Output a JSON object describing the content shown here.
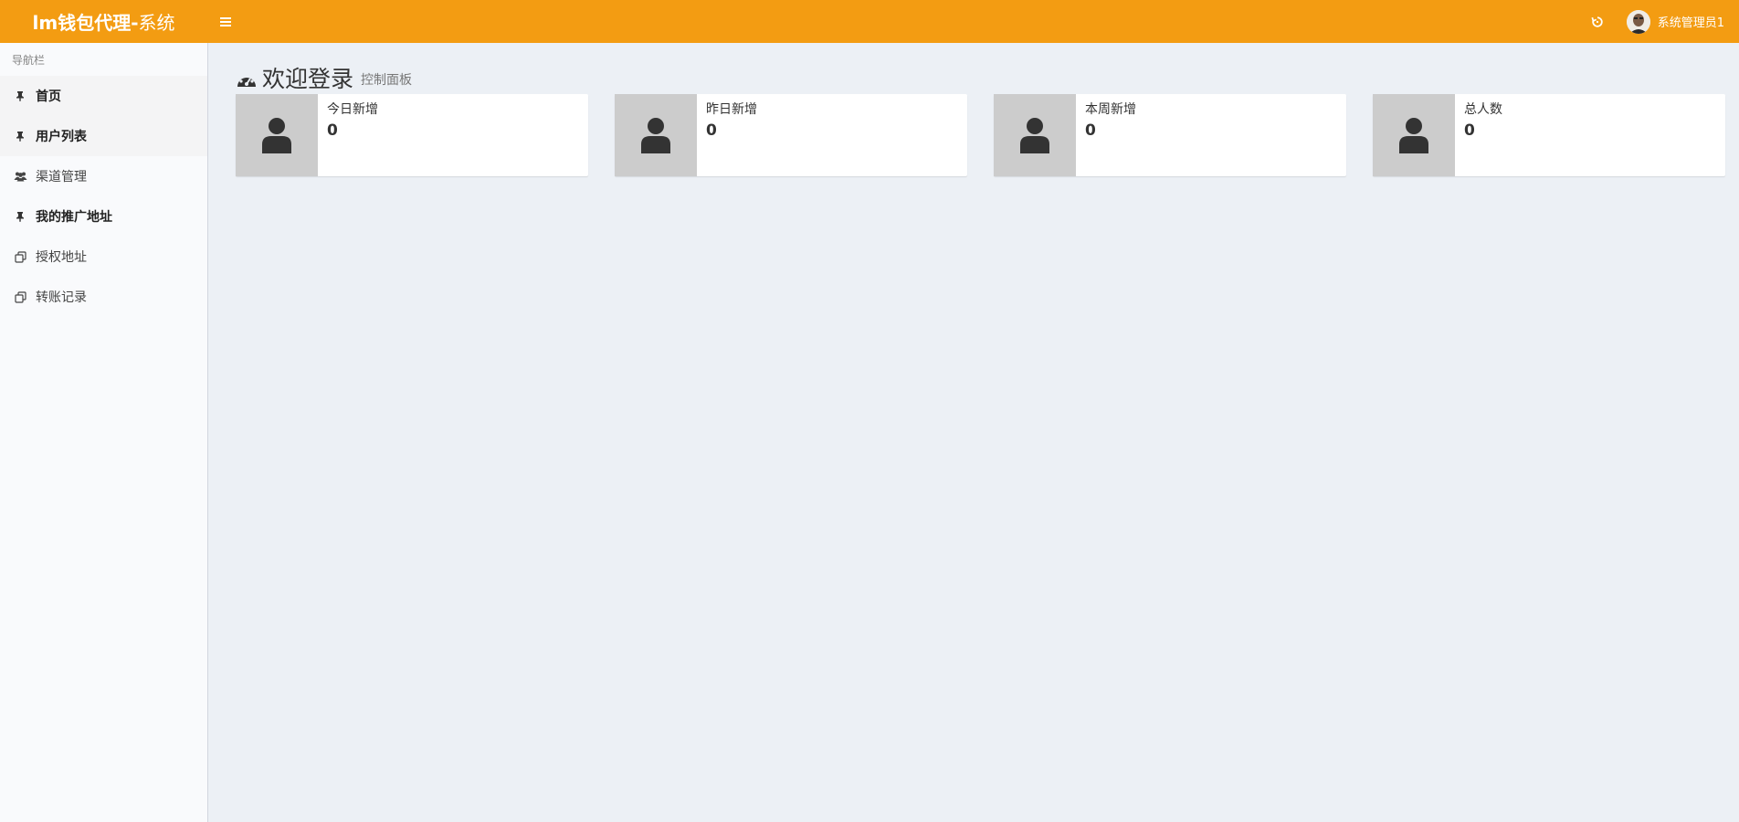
{
  "header": {
    "logo_bold": "lm钱包代理-",
    "logo_light": "系统",
    "username": "系统管理员1",
    "brand_color": "#f39c12"
  },
  "sidebar": {
    "title": "导航栏",
    "items": [
      {
        "label": "首页",
        "icon": "pin-icon"
      },
      {
        "label": "用户列表",
        "icon": "pin-icon"
      },
      {
        "label": "渠道管理",
        "icon": "users-icon"
      },
      {
        "label": "我的推广地址",
        "icon": "pin-icon"
      },
      {
        "label": "授权地址",
        "icon": "copy-icon"
      },
      {
        "label": "转账记录",
        "icon": "copy-icon"
      }
    ]
  },
  "main": {
    "title": "欢迎登录",
    "subtitle": "控制面板",
    "stats": [
      {
        "label": "今日新增",
        "value": "0"
      },
      {
        "label": "昨日新增",
        "value": "0"
      },
      {
        "label": "本周新增",
        "value": "0"
      },
      {
        "label": "总人数",
        "value": "0"
      }
    ]
  }
}
